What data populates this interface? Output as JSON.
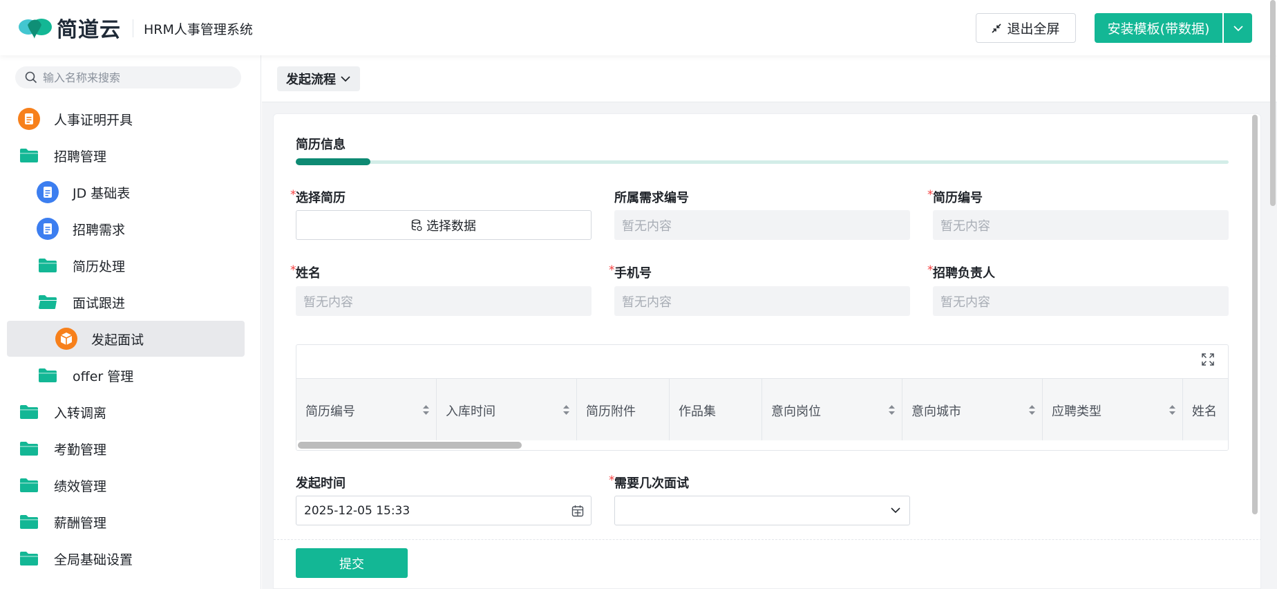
{
  "header": {
    "logo_text": "简道云",
    "app_title": "HRM人事管理系统",
    "exit_fullscreen_label": "退出全屏",
    "install_label": "安装模板(带数据)",
    "brand_color": "#13b795"
  },
  "sidebar": {
    "search_placeholder": "输入名称来搜索",
    "items": [
      {
        "label": "人事证明开具",
        "icon": "orange-document-icon"
      },
      {
        "label": "招聘管理",
        "icon": "folder-icon"
      },
      {
        "label": "JD 基础表",
        "icon": "blue-document-icon"
      },
      {
        "label": "招聘需求",
        "icon": "blue-document-icon"
      },
      {
        "label": "简历处理",
        "icon": "folder-icon"
      },
      {
        "label": "面试跟进",
        "icon": "folder-open-icon"
      },
      {
        "label": "发起面试",
        "icon": "orange-flow-icon",
        "active": true
      },
      {
        "label": "offer 管理",
        "icon": "folder-icon"
      },
      {
        "label": "入转调离",
        "icon": "folder-icon"
      },
      {
        "label": "考勤管理",
        "icon": "folder-icon"
      },
      {
        "label": "绩效管理",
        "icon": "folder-icon"
      },
      {
        "label": "薪酬管理",
        "icon": "folder-icon"
      },
      {
        "label": "全局基础设置",
        "icon": "folder-icon"
      }
    ]
  },
  "main": {
    "flow_button_label": "发起流程",
    "section_title": "简历信息",
    "fields": {
      "select_resume": {
        "label": "选择简历",
        "button": "选择数据",
        "required": "*"
      },
      "demand_no": {
        "label": "所属需求编号",
        "placeholder": "暂无内容"
      },
      "resume_no": {
        "label": "简历编号",
        "placeholder": "暂无内容",
        "required": "*"
      },
      "name": {
        "label": "姓名",
        "placeholder": "暂无内容",
        "required": "*"
      },
      "phone": {
        "label": "手机号",
        "placeholder": "暂无内容",
        "required": "*"
      },
      "recruiter": {
        "label": "招聘负责人",
        "placeholder": "暂无内容",
        "required": "*"
      },
      "start_time": {
        "label": "发起时间",
        "value": "2025-12-05 15:33"
      },
      "interview_count": {
        "label": "需要几次面试",
        "required": "*",
        "value": ""
      }
    },
    "table": {
      "columns": [
        "简历编号",
        "入库时间",
        "简历附件",
        "作品集",
        "意向岗位",
        "意向城市",
        "应聘类型",
        "姓名"
      ]
    },
    "submit_label": "提交"
  }
}
